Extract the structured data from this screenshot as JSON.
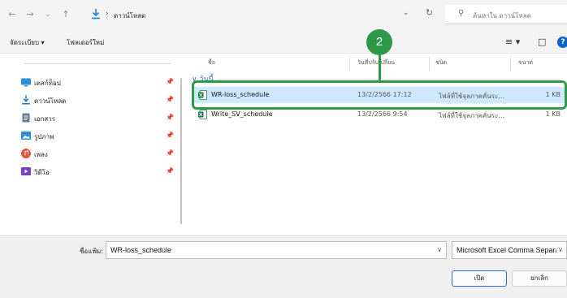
{
  "nav": {
    "back_icon": "arrow-left-icon",
    "forward_icon": "arrow-right-icon",
    "recent_icon": "chevron-down-icon",
    "up_icon": "arrow-up-icon"
  },
  "address": {
    "folder": "ดาวน์โหลด",
    "separator": "›",
    "dropdown": "⌄",
    "refresh": "↻"
  },
  "search": {
    "placeholder": "ค้นหาใน ดาวน์โหลด"
  },
  "toolbar": {
    "organize": "จัดระเบียบ ▾",
    "new_folder": "โฟลเดอร์ใหม่",
    "view_menu": "≡ ▾",
    "preview": "□",
    "help": "?"
  },
  "sidebar": {
    "items": [
      {
        "label": "เดสก์ท็อป",
        "icon": "desktop-icon",
        "color": "#2a8fd6"
      },
      {
        "label": "ดาวน์โหลด",
        "icon": "download-icon",
        "color": "#1f7fd1"
      },
      {
        "label": "เอกสาร",
        "icon": "document-icon",
        "color": "#6a7c93"
      },
      {
        "label": "รูปภาพ",
        "icon": "pictures-icon",
        "color": "#2a8fd6"
      },
      {
        "label": "เพลง",
        "icon": "music-icon",
        "color": "#e0543c"
      },
      {
        "label": "วิดีโอ",
        "icon": "video-icon",
        "color": "#7a3fbf"
      }
    ]
  },
  "columns": {
    "name": "ชื่อ",
    "date": "วันที่ปรับเปลี่ยน",
    "type": "ชนิด",
    "size": "ขนาด"
  },
  "group": {
    "label": "∨ วันนี้"
  },
  "files": [
    {
      "name": "WR-loss_schedule",
      "date": "13/2/2566 17:12",
      "type": "ไฟล์ที่ใช้จุลภาคคั่นระ...",
      "size": "1 KB",
      "selected": true
    },
    {
      "name": "Write_SV_schedule",
      "date": "13/2/2566 9:54",
      "type": "ไฟล์ที่ใช้จุลภาคคั่นระ...",
      "size": "1 KB",
      "selected": false
    }
  ],
  "callout": {
    "number": "2",
    "color": "#2e9a48"
  },
  "bottom": {
    "filename_label": "ชื่อแฟ้ม:",
    "filename_value": "WR-loss_schedule",
    "filetype": "Microsoft Excel Comma Separa",
    "open": "เปิด",
    "cancel": "ยกเลิก"
  }
}
